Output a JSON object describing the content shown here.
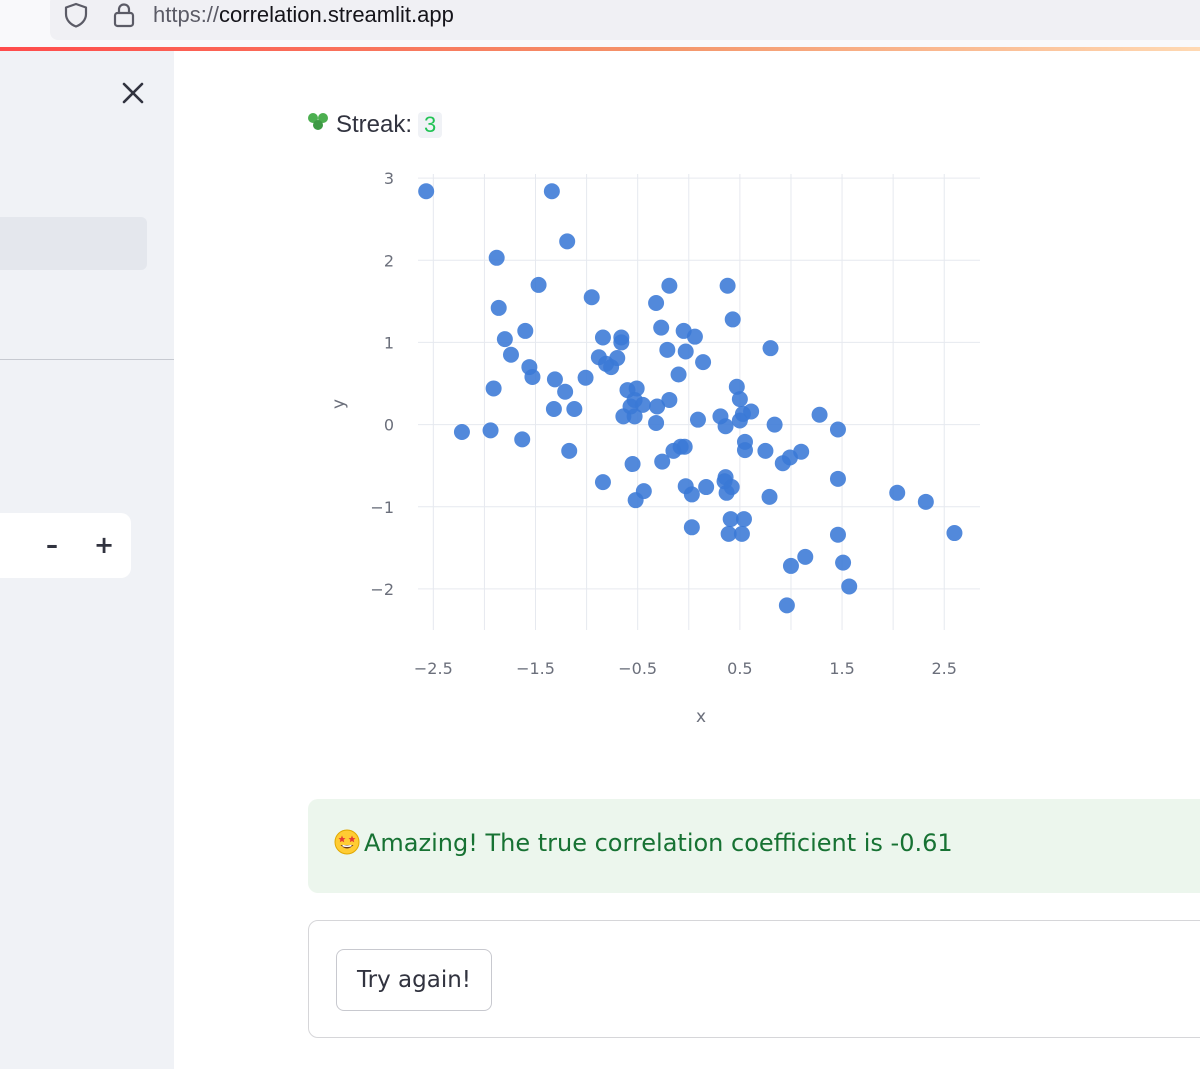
{
  "browser": {
    "url_scheme": "https://",
    "url_host": "correlation.streamlit.app"
  },
  "sidebar": {
    "stepper": {
      "minus_label": "–",
      "plus_label": "+"
    }
  },
  "main": {
    "streak_label": "Streak:",
    "streak_value": "3",
    "success_message": "Amazing! The true correlation coefficient is -0.61",
    "try_again_label": "Try again!"
  },
  "colors": {
    "point": "#3a79d6",
    "success_bg": "#ecf6ed",
    "success_text": "#177233",
    "streak_value": "#21c354"
  },
  "chart_data": {
    "type": "scatter",
    "title": "",
    "xlabel": "x",
    "ylabel": "y",
    "xlim": [
      -2.65,
      2.85
    ],
    "ylim": [
      -2.5,
      3.05
    ],
    "x_ticks": [
      -2.5,
      -1.5,
      -0.5,
      0.5,
      1.5,
      2.5
    ],
    "x_tick_labels": [
      "−2.5",
      "−1.5",
      "−0.5",
      "0.5",
      "1.5",
      "2.5"
    ],
    "y_ticks": [
      3,
      2,
      1,
      0,
      -1,
      -2
    ],
    "y_tick_labels": [
      "3",
      "2",
      "1",
      "0",
      "−1",
      "−2"
    ],
    "grid": true,
    "points": [
      [
        -2.57,
        2.84
      ],
      [
        -1.34,
        2.84
      ],
      [
        -1.19,
        2.23
      ],
      [
        -1.88,
        2.03
      ],
      [
        -1.47,
        1.7
      ],
      [
        -0.95,
        1.55
      ],
      [
        -1.86,
        1.42
      ],
      [
        -1.6,
        1.14
      ],
      [
        -1.8,
        1.04
      ],
      [
        -1.74,
        0.85
      ],
      [
        -1.56,
        0.7
      ],
      [
        -1.53,
        0.58
      ],
      [
        -1.91,
        0.44
      ],
      [
        -1.31,
        0.55
      ],
      [
        -1.21,
        0.4
      ],
      [
        -1.01,
        0.57
      ],
      [
        -1.32,
        0.19
      ],
      [
        -1.12,
        0.19
      ],
      [
        -1.94,
        -0.07
      ],
      [
        -2.22,
        -0.09
      ],
      [
        -1.63,
        -0.18
      ],
      [
        -1.17,
        -0.32
      ],
      [
        -0.84,
        -0.7
      ],
      [
        -0.84,
        1.06
      ],
      [
        -0.66,
        1.06
      ],
      [
        -0.66,
        1.0
      ],
      [
        -0.88,
        0.82
      ],
      [
        -0.81,
        0.74
      ],
      [
        -0.76,
        0.7
      ],
      [
        -0.7,
        0.81
      ],
      [
        -0.6,
        0.42
      ],
      [
        -0.51,
        0.44
      ],
      [
        -0.53,
        0.3
      ],
      [
        -0.57,
        0.22
      ],
      [
        -0.45,
        0.24
      ],
      [
        -0.64,
        0.1
      ],
      [
        -0.53,
        0.1
      ],
      [
        -0.32,
        1.48
      ],
      [
        -0.19,
        1.69
      ],
      [
        -0.27,
        1.18
      ],
      [
        -0.05,
        1.14
      ],
      [
        0.06,
        1.07
      ],
      [
        -0.21,
        0.91
      ],
      [
        -0.03,
        0.89
      ],
      [
        0.14,
        0.76
      ],
      [
        -0.1,
        0.61
      ],
      [
        -0.31,
        0.22
      ],
      [
        -0.19,
        0.3
      ],
      [
        -0.32,
        0.02
      ],
      [
        0.38,
        1.69
      ],
      [
        0.43,
        1.28
      ],
      [
        0.8,
        0.93
      ],
      [
        0.47,
        0.46
      ],
      [
        0.5,
        0.31
      ],
      [
        0.5,
        0.05
      ],
      [
        0.53,
        0.13
      ],
      [
        0.61,
        0.16
      ],
      [
        0.31,
        0.1
      ],
      [
        0.09,
        0.06
      ],
      [
        0.36,
        -0.02
      ],
      [
        0.84,
        0.0
      ],
      [
        1.28,
        0.12
      ],
      [
        1.46,
        -0.06
      ],
      [
        0.55,
        -0.21
      ],
      [
        0.55,
        -0.31
      ],
      [
        0.75,
        -0.32
      ],
      [
        0.99,
        -0.4
      ],
      [
        0.92,
        -0.47
      ],
      [
        1.1,
        -0.33
      ],
      [
        -0.26,
        -0.45
      ],
      [
        -0.04,
        -0.27
      ],
      [
        -0.08,
        -0.27
      ],
      [
        -0.15,
        -0.32
      ],
      [
        -0.55,
        -0.48
      ],
      [
        -0.52,
        -0.92
      ],
      [
        -0.44,
        -0.81
      ],
      [
        -0.03,
        -0.75
      ],
      [
        0.03,
        -0.85
      ],
      [
        0.17,
        -0.76
      ],
      [
        0.36,
        -0.64
      ],
      [
        0.35,
        -0.69
      ],
      [
        0.42,
        -0.76
      ],
      [
        0.37,
        -0.83
      ],
      [
        0.79,
        -0.88
      ],
      [
        0.41,
        -1.15
      ],
      [
        0.54,
        -1.15
      ],
      [
        0.39,
        -1.33
      ],
      [
        0.52,
        -1.33
      ],
      [
        0.03,
        -1.25
      ],
      [
        1.46,
        -0.66
      ],
      [
        2.04,
        -0.83
      ],
      [
        2.32,
        -0.94
      ],
      [
        2.6,
        -1.32
      ],
      [
        1.46,
        -1.34
      ],
      [
        1.14,
        -1.61
      ],
      [
        1.0,
        -1.72
      ],
      [
        1.51,
        -1.68
      ],
      [
        1.57,
        -1.97
      ],
      [
        0.96,
        -2.2
      ]
    ]
  }
}
